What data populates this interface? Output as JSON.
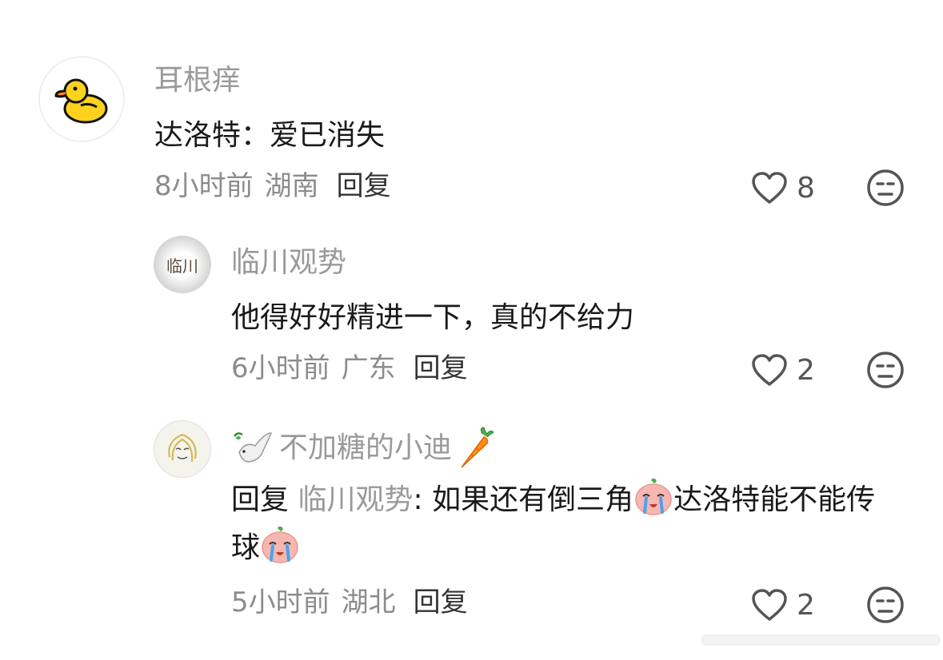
{
  "comments": [
    {
      "username": "耳根痒",
      "text": "达洛特：爱已消失",
      "time": "8小时前",
      "location": "湖南",
      "reply_label": "回复",
      "likes": "8"
    },
    {
      "username": "临川观势",
      "avatar_text": "临川",
      "text": "他得好好精进一下，真的不给力",
      "time": "6小时前",
      "location": "广东",
      "reply_label": "回复",
      "likes": "2"
    },
    {
      "username": "不加糖的小迪",
      "reply_prefix": "回复",
      "reply_to": "临川观势",
      "reply_colon": ": ",
      "text_part1": "如果还有倒三角",
      "text_part2": "达洛特能不能传球",
      "time": "5小时前",
      "location": "湖北",
      "reply_label": "回复",
      "likes": "2"
    }
  ],
  "icons": {
    "like": "heart-outline-icon",
    "react": "meh-face-icon",
    "duck": "duck-avatar-icon",
    "dove": "dove-emoji-icon",
    "carrot": "carrot-emoji-icon",
    "crying": "crying-face-emoji-icon"
  },
  "colors": {
    "username": "#9a9a9a",
    "text": "#1a1a1a",
    "meta": "#8c8c8c",
    "duck_yellow": "#FFD21E"
  }
}
